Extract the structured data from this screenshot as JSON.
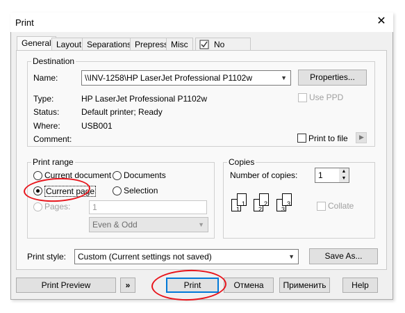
{
  "window": {
    "title": "Print",
    "close_glyph": "✕"
  },
  "tabs": [
    {
      "label": "General"
    },
    {
      "label": "Layout"
    },
    {
      "label": "Separations"
    },
    {
      "label": "Prepress"
    },
    {
      "label": "Misc"
    },
    {
      "label": "No Issues"
    }
  ],
  "destination": {
    "legend": "Destination",
    "name_label": "Name:",
    "name_value": "\\\\INV-1258\\HP LaserJet Professional P1102w",
    "properties_label": "Properties...",
    "use_ppd_label": "Use PPD",
    "type_label": "Type:",
    "type_value": "HP LaserJet Professional P1102w",
    "status_label": "Status:",
    "status_value": "Default printer; Ready",
    "where_label": "Where:",
    "where_value": "USB001",
    "comment_label": "Comment:",
    "print_to_file_label": "Print to file"
  },
  "print_range": {
    "legend": "Print range",
    "current_document": "Current document",
    "documents": "Documents",
    "current_page": "Current page",
    "selection": "Selection",
    "pages": "Pages:",
    "pages_value": "1",
    "even_odd": "Even & Odd",
    "selected": "current_page"
  },
  "copies": {
    "legend": "Copies",
    "number_label": "Number of copies:",
    "number_value": "1",
    "collate_label": "Collate"
  },
  "print_style": {
    "label": "Print style:",
    "value": "Custom (Current settings not saved)",
    "save_as_label": "Save As..."
  },
  "footer": {
    "print_preview": "Print Preview",
    "expand_glyph": "»",
    "print": "Print",
    "cancel": "Отмена",
    "apply": "Применить",
    "help": "Help"
  },
  "annotation_color": "#e8141b"
}
